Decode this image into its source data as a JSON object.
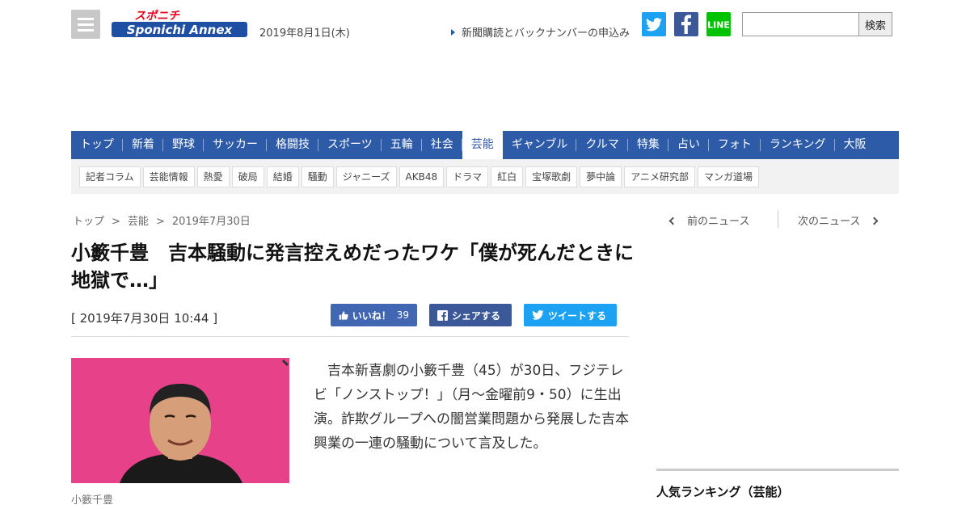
{
  "header": {
    "logo_top": "スポニチ",
    "logo_bottom": "Sponichi Annex",
    "date": "2019年8月1日(木)",
    "subscribe_link": "新聞購読とバックナンバーの申込み",
    "line_label": "LINE",
    "search": {
      "placeholder": "",
      "button_label": "検索"
    }
  },
  "main_nav": [
    {
      "label": "トップ"
    },
    {
      "label": "新着"
    },
    {
      "label": "野球"
    },
    {
      "label": "サッカー"
    },
    {
      "label": "格闘技"
    },
    {
      "label": "スポーツ"
    },
    {
      "label": "五輪"
    },
    {
      "label": "社会"
    },
    {
      "label": "芸能",
      "active": true
    },
    {
      "label": "ギャンブル"
    },
    {
      "label": "クルマ"
    },
    {
      "label": "特集"
    },
    {
      "label": "占い"
    },
    {
      "label": "フォト"
    },
    {
      "label": "ランキング"
    },
    {
      "label": "大阪"
    }
  ],
  "sub_nav": [
    "記者コラム",
    "芸能情報",
    "熱愛",
    "破局",
    "結婚",
    "騒動",
    "ジャニーズ",
    "AKB48",
    "ドラマ",
    "紅白",
    "宝塚歌劇",
    "夢中論",
    "アニメ研究部",
    "マンガ道場"
  ],
  "breadcrumb": {
    "items": [
      "トップ",
      "芸能",
      "2019年7月30日"
    ],
    "separator": ">"
  },
  "news_nav": {
    "prev": "前のニュース",
    "next": "次のニュース"
  },
  "article": {
    "headline": "小籔千豊　吉本騒動に発言控えめだったワケ「僕が死んだときに地獄で…」",
    "date": "[ 2019年7月30日 10:44 ]",
    "share": {
      "like_label": "いいね！",
      "like_count": "39",
      "share_label": "シェアする",
      "tweet_label": "ツイートする"
    },
    "photo_caption": "小籔千豊",
    "body": "　吉本新喜劇の小籔千豊（45）が30日、フジテレビ「ノンストップ！」（月～金曜前9・50）に生出演。詐欺グループへの闇営業問題から発展した吉本興業の一連の騒動について言及した。"
  },
  "sidebar": {
    "ranking_title": "人気ランキング（芸能）"
  },
  "colors": {
    "nav_blue": "#2e5ba8",
    "twitter": "#1da1f2",
    "facebook": "#3b5998",
    "line": "#00c300",
    "photo_bg": "#e64189"
  }
}
